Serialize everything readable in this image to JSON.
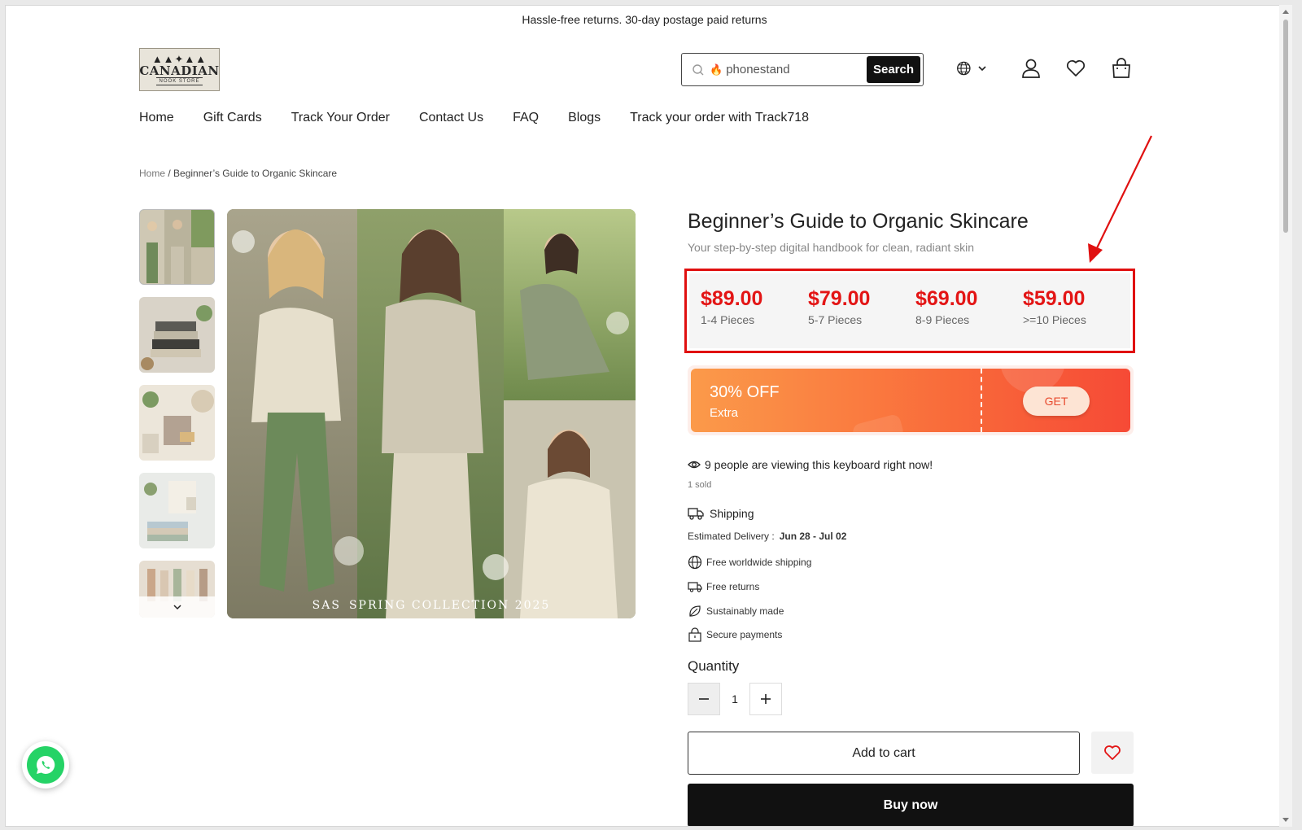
{
  "announcement": "Hassle-free returns. 30-day postage paid returns",
  "logo": {
    "text": "CANADIAN",
    "subtext": "NOOK STORE"
  },
  "search": {
    "value": "phonestand",
    "button_label": "Search"
  },
  "header_icons": [
    "globe-icon",
    "user-icon",
    "heart-icon",
    "bag-icon"
  ],
  "nav": [
    {
      "label": "Home"
    },
    {
      "label": "Gift Cards"
    },
    {
      "label": "Track Your Order"
    },
    {
      "label": "Contact Us"
    },
    {
      "label": "FAQ"
    },
    {
      "label": "Blogs"
    },
    {
      "label": "Track your order with Track718"
    }
  ],
  "breadcrumb": {
    "home": "Home",
    "separator": " / ",
    "current": "Beginner’s Guide to Organic Skincare"
  },
  "gallery": {
    "caption_brand": "SAS",
    "caption_text": "SPRING COLLECTION 2025",
    "thumbnail_count": 5
  },
  "product": {
    "title": "Beginner’s Guide to Organic Skincare",
    "subtitle": "Your step-by-step digital handbook for clean, radiant skin",
    "tiers": [
      {
        "price": "$89.00",
        "qty": "1-4 Pieces"
      },
      {
        "price": "$79.00",
        "qty": "5-7 Pieces"
      },
      {
        "price": "$69.00",
        "qty": "8-9 Pieces"
      },
      {
        "price": "$59.00",
        "qty": ">=10 Pieces"
      }
    ],
    "coupon": {
      "percent": "30% OFF",
      "label": "Extra",
      "button": "GET"
    },
    "viewing": "9 people are viewing this keyboard right now!",
    "sold": "1 sold",
    "shipping_label": "Shipping",
    "estimated_label": "Estimated Delivery :",
    "estimated_value": "Jun 28 - Jul 02",
    "features": [
      "Free worldwide shipping",
      "Free returns",
      "Sustainably made",
      "Secure payments"
    ],
    "quantity_label": "Quantity",
    "quantity_value": "1",
    "add_to_cart": "Add to cart",
    "buy_now": "Buy now"
  },
  "colors": {
    "price_red": "#e31515",
    "highlight_border": "#e01010",
    "coupon_start": "#fb9a4a",
    "coupon_end": "#f64a36",
    "whatsapp": "#25d366"
  }
}
